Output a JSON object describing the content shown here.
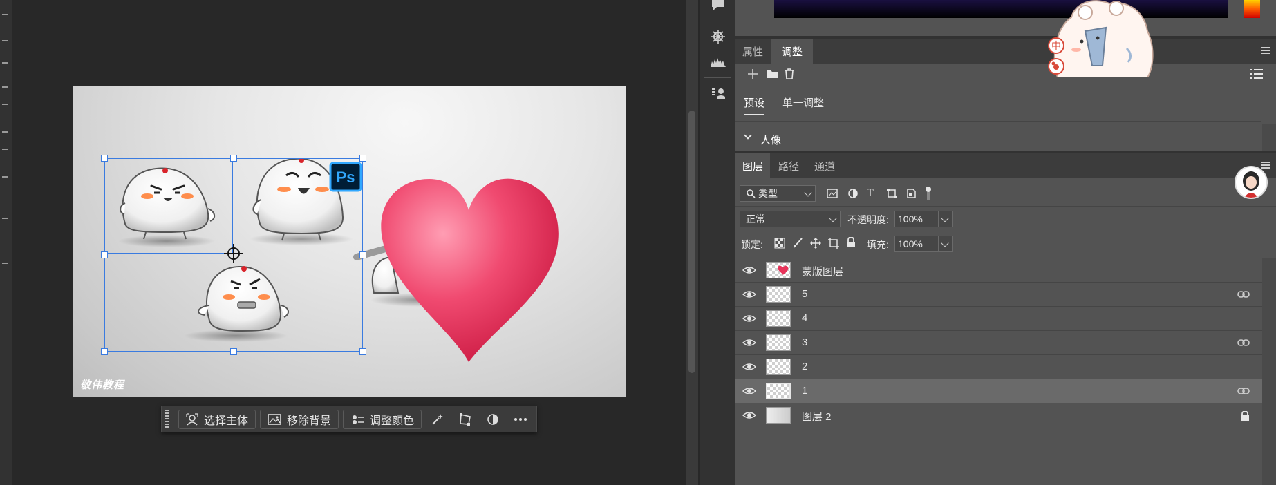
{
  "taskbar": {
    "select_subject": "选择主体",
    "remove_background": "移除背景",
    "adjust_color": "调整颜色"
  },
  "canvas": {
    "watermark": "敬伟教程",
    "ps_badge": "Ps"
  },
  "adjust_panel": {
    "tabs": [
      "属性",
      "调整"
    ],
    "subtabs": [
      "预设",
      "单一调整"
    ],
    "group_label": "人像"
  },
  "layers_panel": {
    "tabs": [
      "图层",
      "路径",
      "通道"
    ],
    "filter_type": "类型",
    "blend_mode": "正常",
    "opacity_label": "不透明度:",
    "opacity_value": "100%",
    "lock_label": "锁定:",
    "fill_label": "填充:",
    "fill_value": "100%",
    "layers": [
      {
        "name": "蒙版图层",
        "linked": false,
        "locked": false,
        "selected": false
      },
      {
        "name": "5",
        "linked": true,
        "locked": false,
        "selected": false
      },
      {
        "name": "4",
        "linked": false,
        "locked": false,
        "selected": false
      },
      {
        "name": "3",
        "linked": true,
        "locked": false,
        "selected": false
      },
      {
        "name": "2",
        "linked": false,
        "locked": false,
        "selected": false
      },
      {
        "name": "1",
        "linked": true,
        "locked": false,
        "selected": true
      },
      {
        "name": "图层 2",
        "linked": false,
        "locked": true,
        "selected": false
      }
    ]
  },
  "overlay": {
    "ime_char": "中"
  },
  "colors": {
    "accent_selection": "#3a7be0",
    "heart": "#e8335a",
    "panel_bg": "#535353"
  }
}
